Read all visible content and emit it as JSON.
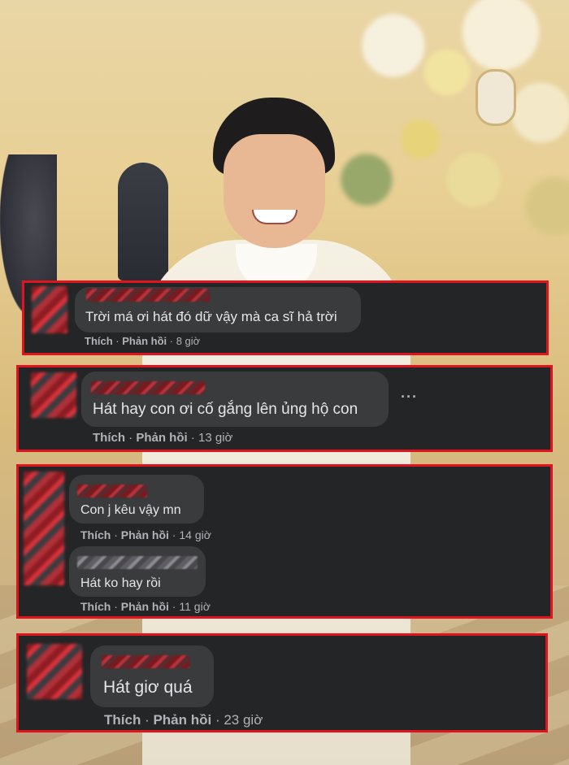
{
  "comments": [
    {
      "text": "Trời má ơi hát đó dữ vậy mà ca sĩ hả trời",
      "like": "Thích",
      "reply": "Phản hồi",
      "time": "8 giờ"
    },
    {
      "text": "Hát hay con ơi cố gắng lên ủng hộ con",
      "like": "Thích",
      "reply": "Phản hồi",
      "time": "13 giờ",
      "more": "···"
    },
    {
      "text": "Con j kêu vậy mn",
      "like": "Thích",
      "reply": "Phản hồi",
      "time": "14 giờ"
    },
    {
      "text": "Hát ko hay rồi",
      "like": "Thích",
      "reply": "Phản hồi",
      "time": "11 giờ"
    },
    {
      "text": "Hát giơ quá",
      "like": "Thích",
      "reply": "Phản hồi",
      "time": "23 giờ"
    }
  ],
  "colors": {
    "box_bg": "#242526",
    "box_border": "#e0141e",
    "bubble_bg": "#3a3b3c",
    "text": "#e4e6eb",
    "meta": "#b0b3b8"
  }
}
